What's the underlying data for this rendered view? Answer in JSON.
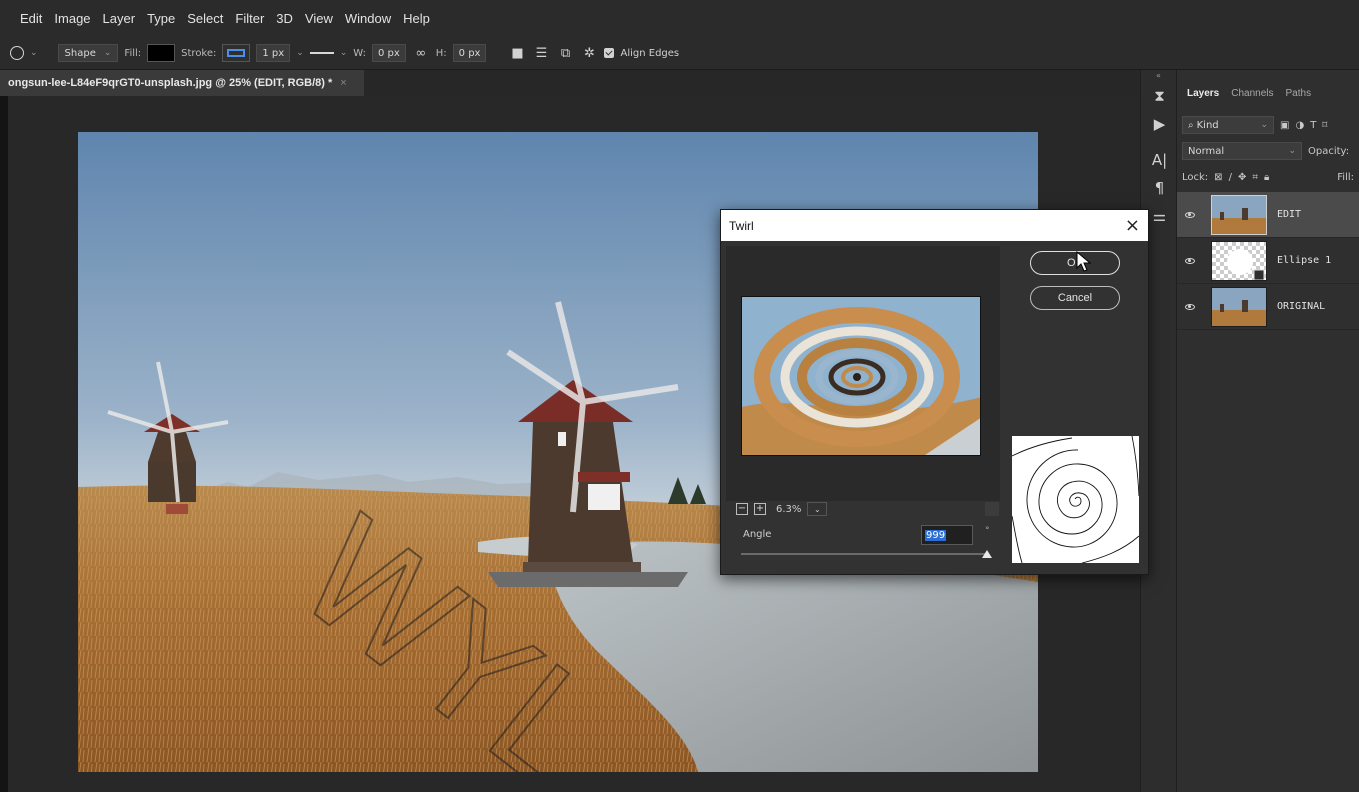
{
  "menu": [
    "Edit",
    "Image",
    "Layer",
    "Type",
    "Select",
    "Filter",
    "3D",
    "View",
    "Window",
    "Help"
  ],
  "options": {
    "shape_mode": "Shape",
    "fill_label": "Fill:",
    "stroke_label": "Stroke:",
    "stroke_width": "1 px",
    "w_label": "W:",
    "w_value": "0 px",
    "h_label": "H:",
    "h_value": "0 px",
    "align_edges": "Align Edges"
  },
  "document": {
    "tab_title": "ongsun-lee-L84eF9qrGT0-unsplash.jpg @ 25% (EDIT, RGB/8) *",
    "close": "×"
  },
  "panel": {
    "tabs": [
      "Layers",
      "Channels",
      "Paths"
    ],
    "filter_kind": "Kind",
    "blend_mode": "Normal",
    "opacity_label": "Opacity:",
    "lock_label": "Lock:",
    "fill_label": "Fill:",
    "layers": [
      {
        "name": "EDIT",
        "selected": true
      },
      {
        "name": "Ellipse 1",
        "selected": false
      },
      {
        "name": "ORIGINAL",
        "selected": false
      }
    ]
  },
  "dialog": {
    "title": "Twirl",
    "close": "×",
    "ok_label": "OK",
    "cancel_label": "Cancel",
    "zoom": "6.3%",
    "angle_label": "Angle",
    "angle_value": "999",
    "degree": "°",
    "angle_slider_fraction": 1.0
  },
  "colors": {
    "accent_blue": "#2b6fd6",
    "ui_bg": "#2b2b2b",
    "panel_bg": "#2f2f2f"
  }
}
